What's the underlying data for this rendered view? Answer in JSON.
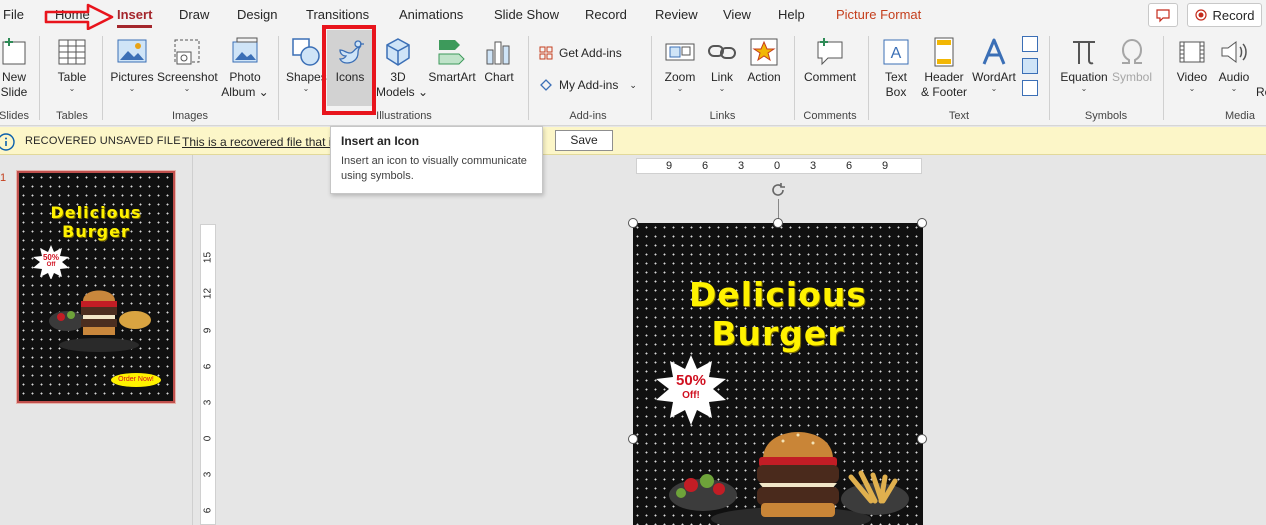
{
  "tabs": [
    "File",
    "Home",
    "Insert",
    "Draw",
    "Design",
    "Transitions",
    "Animations",
    "Slide Show",
    "Record",
    "Review",
    "View",
    "Help",
    "Picture Format"
  ],
  "record_label": "Record",
  "ribbon": {
    "new_slide": [
      "New",
      "Slide"
    ],
    "table": "Table",
    "pictures": "Pictures",
    "screenshot": "Screenshot",
    "photo_album": [
      "Photo",
      "Album"
    ],
    "shapes": "Shapes",
    "icons": "Icons",
    "models_3d": [
      "3D",
      "Models"
    ],
    "smartart": "SmartArt",
    "chart": "Chart",
    "get_addins": "Get Add-ins",
    "my_addins": "My Add-ins",
    "zoom": "Zoom",
    "link": "Link",
    "action": "Action",
    "comment": "Comment",
    "text_box": [
      "Text",
      "Box"
    ],
    "header_footer": [
      "Header",
      "& Footer"
    ],
    "wordart": "WordArt",
    "equation": "Equation",
    "symbol": "Symbol",
    "video": "Video",
    "audio": "Audio",
    "overflow": "Re",
    "groups": {
      "slides": "Slides",
      "tables": "Tables",
      "images": "Images",
      "illustrations": "Illustrations",
      "addins": "Add-ins",
      "links": "Links",
      "comments": "Comments",
      "text": "Text",
      "symbols": "Symbols",
      "media": "Media"
    }
  },
  "infobar": {
    "title": "RECOVERED UNSAVED FILE",
    "message": "This is a recovered file that is",
    "save_label": "Save"
  },
  "tooltip": {
    "title": "Insert an Icon",
    "body": "Insert an icon to visually communicate using symbols."
  },
  "thumbnail": {
    "number": "1",
    "title_line1": "Delicious",
    "title_line2": "Burger",
    "badge_line1": "50%",
    "badge_line2": "Off",
    "cta": "Order Now!"
  },
  "ruler_h": [
    "9",
    "6",
    "3",
    "0",
    "3",
    "6",
    "9"
  ],
  "ruler_v": [
    "15",
    "12",
    "9",
    "6",
    "3",
    "0",
    "3",
    "6"
  ],
  "slide": {
    "title_line1": "Delicious",
    "title_line2": "Burger",
    "badge_line1": "50%",
    "badge_line2": "Off!"
  },
  "colors": {
    "accent": "#a4262c",
    "annotation_red": "#e8141c",
    "title_yellow": "#fff200",
    "infobar_bg": "#fcf6c8"
  }
}
